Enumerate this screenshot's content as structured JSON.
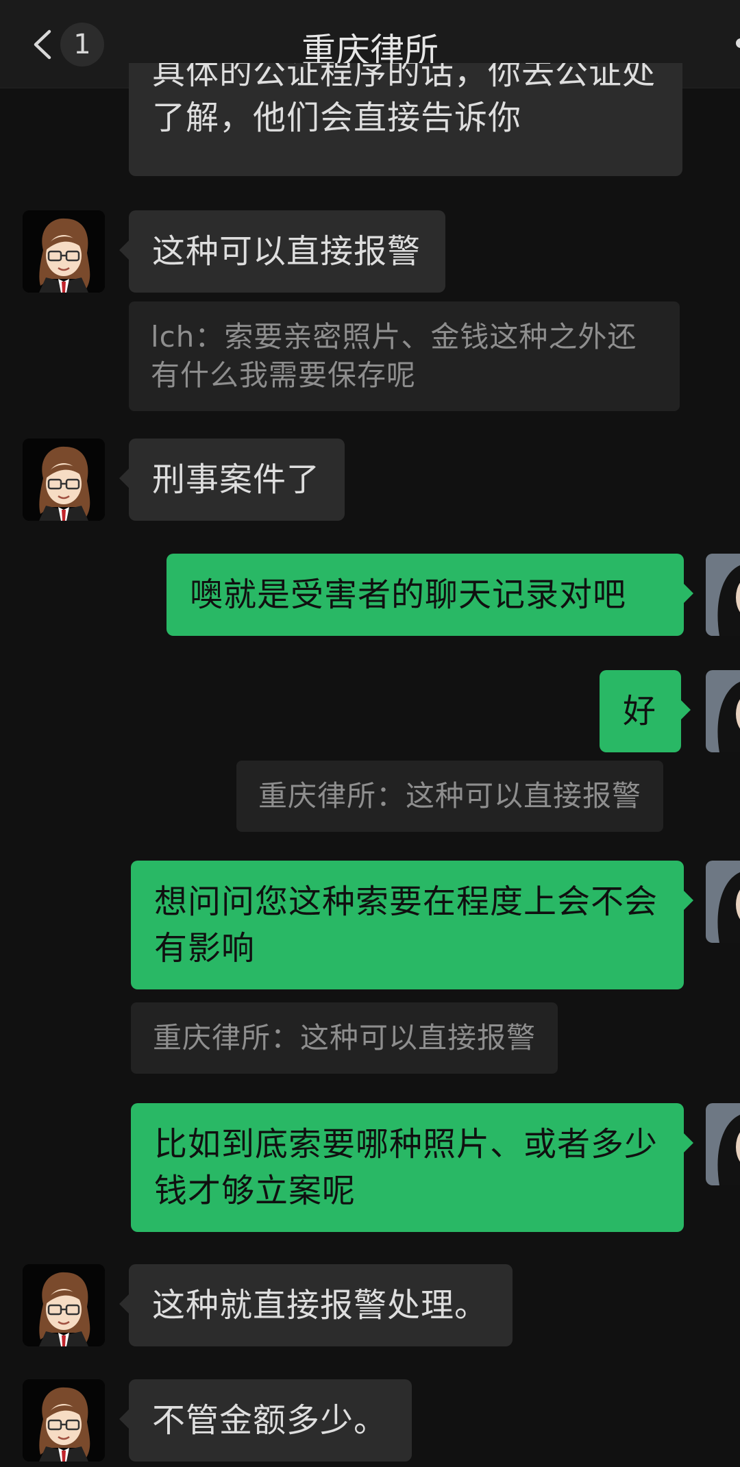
{
  "header": {
    "title": "重庆律所",
    "unread_count": "1"
  },
  "messages": [
    {
      "type": "text",
      "from": "other",
      "text": "具体的公证程序的话，你去公证处了解，他们会直接告诉你"
    },
    {
      "type": "text",
      "from": "other",
      "text": "这种可以直接报警"
    },
    {
      "type": "quote",
      "text": "lch：索要亲密照片、金钱这种之外还有什么我需要保存呢"
    },
    {
      "type": "text",
      "from": "other",
      "text": "刑事案件了"
    },
    {
      "type": "text",
      "from": "me",
      "text": "噢就是受害者的聊天记录对吧"
    },
    {
      "type": "text",
      "from": "me",
      "text": "好"
    },
    {
      "type": "quote",
      "text": "重庆律所：这种可以直接报警"
    },
    {
      "type": "text",
      "from": "me",
      "text": "想问问您这种索要在程度上会不会有影响"
    },
    {
      "type": "quote",
      "text": "重庆律所：这种可以直接报警"
    },
    {
      "type": "text",
      "from": "me",
      "text": "比如到底索要哪种照片、或者多少钱才够立案呢"
    },
    {
      "type": "text",
      "from": "other",
      "text": "这种就直接报警处理。"
    },
    {
      "type": "text",
      "from": "other",
      "text": "不管金额多少。"
    }
  ],
  "icons": {
    "back": "chevron-left-icon",
    "more": "more-icon"
  },
  "colors": {
    "background": "#111111",
    "my_bubble": "#29b865",
    "other_bubble": "#2c2c2c"
  }
}
